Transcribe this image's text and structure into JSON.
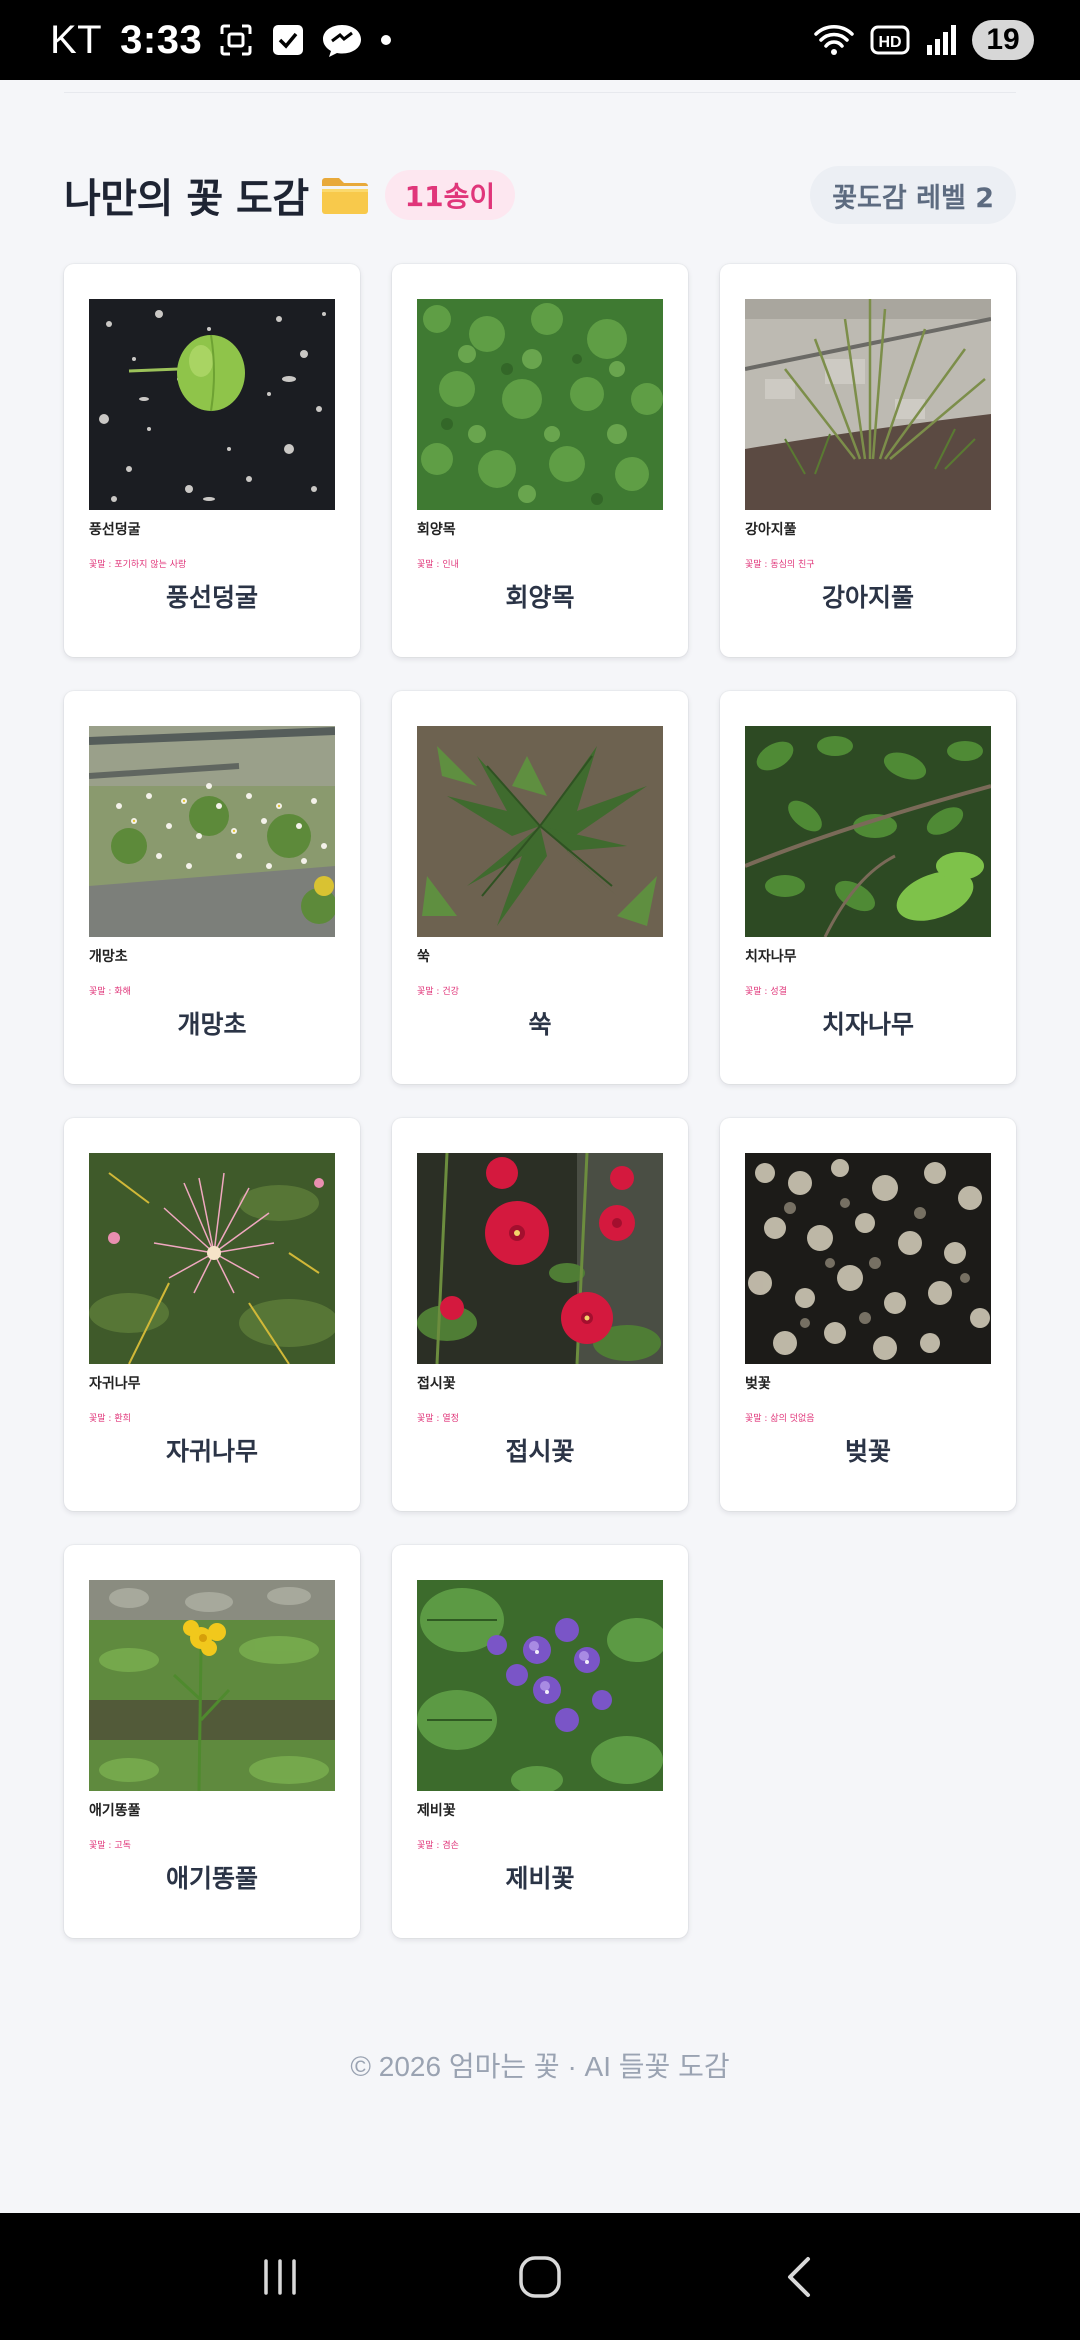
{
  "status_bar": {
    "carrier": "KT",
    "time": "3:33",
    "battery": "19",
    "icons": [
      "screenshot-icon",
      "checkbox-icon",
      "chat-bubble-icon",
      "dot-icon",
      "wifi-icon",
      "hd-icon",
      "signal-icon"
    ]
  },
  "header": {
    "title": "나만의 꽃 도감",
    "title_icon": "folder-icon",
    "count": "11송이",
    "level": "꽃도감 레벨 2"
  },
  "cards": [
    {
      "small_name": "풍선덩굴",
      "meaning": "꽃말 : 포기하지 않는 사랑",
      "name": "풍선덩굴",
      "photo": "green-seed-pod-on-black-terrazzo"
    },
    {
      "small_name": "회양목",
      "meaning": "꽃말 : 인내",
      "name": "회양목",
      "photo": "dense-green-shrub"
    },
    {
      "small_name": "강아지풀",
      "meaning": "꽃말 : 동심의 친구",
      "name": "강아지풀",
      "photo": "grass-by-stone-wall"
    },
    {
      "small_name": "개망초",
      "meaning": "꽃말 : 화해",
      "name": "개망초",
      "photo": "white-daisy-fleabane-by-railing"
    },
    {
      "small_name": "쑥",
      "meaning": "꽃말 : 건강",
      "name": "쑥",
      "photo": "mugwort-leaves"
    },
    {
      "small_name": "치자나무",
      "meaning": "꽃말 : 성결",
      "name": "치자나무",
      "photo": "green-leafy-branches"
    },
    {
      "small_name": "자귀나무",
      "meaning": "꽃말 : 환희",
      "name": "자귀나무",
      "photo": "pink-silk-tree-flower"
    },
    {
      "small_name": "접시꽃",
      "meaning": "꽃말 : 열정",
      "name": "접시꽃",
      "photo": "red-hollyhock-flowers"
    },
    {
      "small_name": "벚꽃",
      "meaning": "꽃말 : 삶의 덧없음",
      "name": "벚꽃",
      "photo": "cherry-blossom-dark"
    },
    {
      "small_name": "애기똥풀",
      "meaning": "꽃말 : 고독",
      "name": "애기똥풀",
      "photo": "yellow-celandine"
    },
    {
      "small_name": "제비꽃",
      "meaning": "꽃말 : 겸손",
      "name": "제비꽃",
      "photo": "purple-violets"
    }
  ],
  "footer": "© 2026 엄마는 꽃 · AI 들꽃 도감",
  "nav": {
    "recents_icon": "recent-apps-icon",
    "home_icon": "home-icon",
    "back_icon": "back-icon"
  },
  "colors": {
    "accent_pink": "#e0367a",
    "badge_pink_bg": "#fde7f0",
    "level_badge_bg": "#eceff4",
    "page_bg": "#f5f6f9"
  }
}
